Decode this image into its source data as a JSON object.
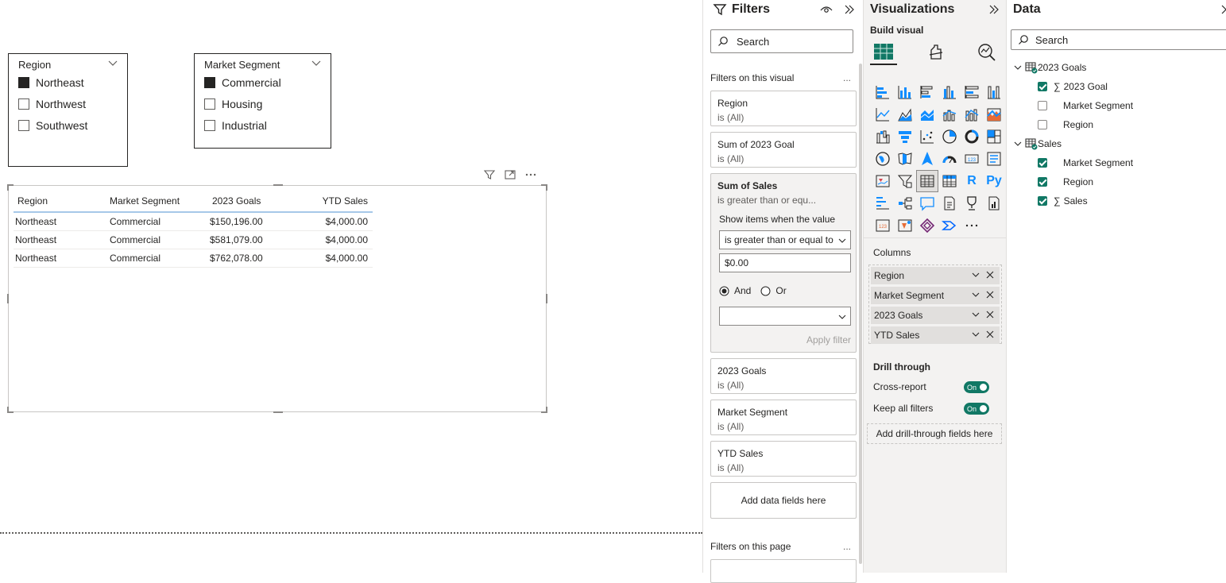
{
  "slicers": {
    "region": {
      "title": "Region",
      "items": [
        {
          "label": "Northeast",
          "checked": true
        },
        {
          "label": "Northwest",
          "checked": false
        },
        {
          "label": "Southwest",
          "checked": false
        }
      ]
    },
    "market_segment": {
      "title": "Market Segment",
      "items": [
        {
          "label": "Commercial",
          "checked": true
        },
        {
          "label": "Housing",
          "checked": false
        },
        {
          "label": "Industrial",
          "checked": false
        }
      ]
    }
  },
  "table": {
    "headers": [
      "Region",
      "Market Segment",
      "2023 Goals",
      "YTD Sales"
    ],
    "rows": [
      [
        "Northeast",
        "Commercial",
        "$150,196.00",
        "$4,000.00"
      ],
      [
        "Northeast",
        "Commercial",
        "$581,079.00",
        "$4,000.00"
      ],
      [
        "Northeast",
        "Commercial",
        "$762,078.00",
        "$4,000.00"
      ]
    ]
  },
  "filters": {
    "title": "Filters",
    "search_placeholder": "Search",
    "on_visual_label": "Filters on this visual",
    "on_page_label": "Filters on this page",
    "more": "...",
    "cards": [
      {
        "field": "Region",
        "state": "is (All)"
      },
      {
        "field": "Sum of 2023 Goal",
        "state": "is (All)"
      }
    ],
    "expanded": {
      "field": "Sum of Sales",
      "state": "is greater than or equ...",
      "show_items_label": "Show items when the value",
      "condition": "is greater than or equal to",
      "value": "$0.00",
      "and_label": "And",
      "or_label": "Or",
      "apply_label": "Apply filter"
    },
    "cards_after": [
      {
        "field": "2023 Goals",
        "state": "is (All)"
      },
      {
        "field": "Market Segment",
        "state": "is (All)"
      },
      {
        "field": "YTD Sales",
        "state": "is (All)"
      }
    ],
    "add_fields": "Add data fields here"
  },
  "visualizations": {
    "title": "Visualizations",
    "build_visual": "Build visual",
    "columns_label": "Columns",
    "columns": [
      "Region",
      "Market Segment",
      "2023 Goals",
      "YTD Sales"
    ],
    "drill_through": "Drill through",
    "cross_report": "Cross-report",
    "keep_all_filters": "Keep all filters",
    "toggle_on": "On",
    "add_drill": "Add drill-through fields here",
    "r_label": "R",
    "py_label": "Py"
  },
  "data": {
    "title": "Data",
    "search_placeholder": "Search",
    "tables": [
      {
        "name": "2023 Goals",
        "fields": [
          {
            "name": "2023 Goal",
            "checked": true,
            "sigma": true
          },
          {
            "name": "Market Segment",
            "checked": false,
            "sigma": false
          },
          {
            "name": "Region",
            "checked": false,
            "sigma": false
          }
        ]
      },
      {
        "name": "Sales",
        "fields": [
          {
            "name": "Market Segment",
            "checked": true,
            "sigma": false
          },
          {
            "name": "Region",
            "checked": true,
            "sigma": false
          },
          {
            "name": "Sales",
            "checked": true,
            "sigma": true
          }
        ]
      }
    ]
  },
  "colors": {
    "accent_green": "#117865",
    "pane_bg": "#f3f2f1",
    "text": "#252423"
  }
}
